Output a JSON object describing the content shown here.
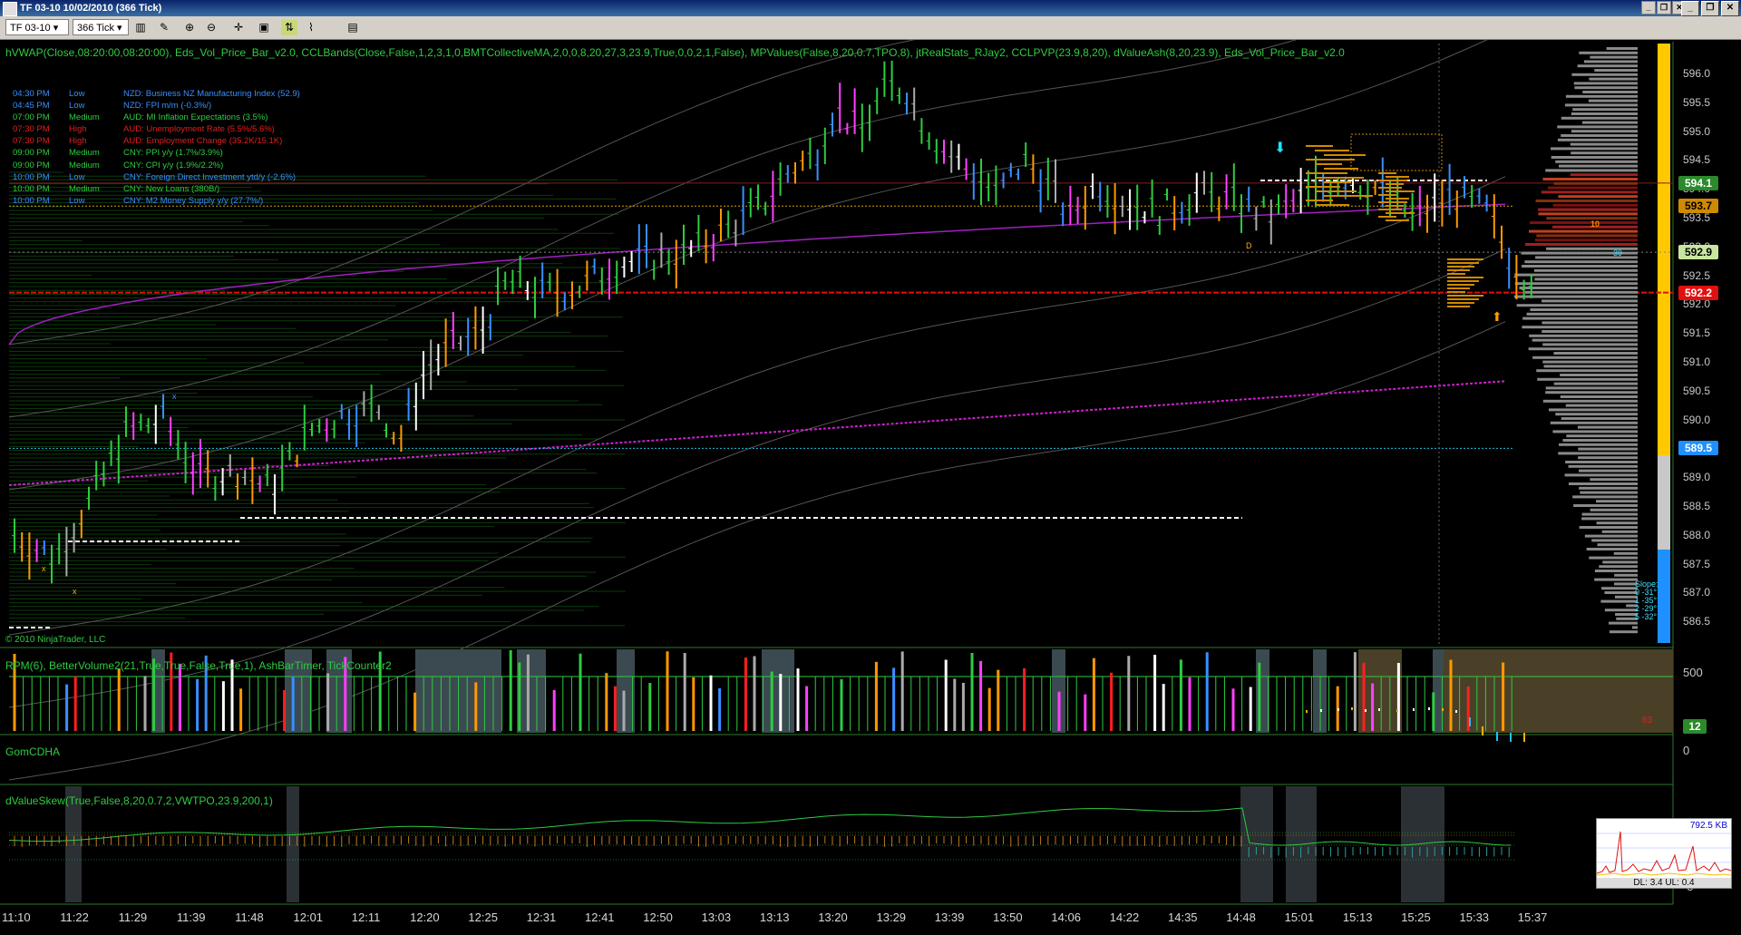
{
  "window": {
    "title": "TF 03-10  10/02/2010 (366 Tick)",
    "minimize_label": "_",
    "restore_label": "❐",
    "close_label": "✕"
  },
  "toolbar": {
    "instrument": "TF 03-10",
    "period": "366 Tick",
    "icons": [
      "bar-type-icon",
      "draw-tool-icon",
      "zoom-in-icon",
      "zoom-out-icon",
      "crosshair-icon",
      "properties-icon",
      "chart-trader-icon",
      "indicators-icon",
      "strategies-icon"
    ]
  },
  "panels": {
    "price_indicators": "hVWAP(Close,08:20:00,08:20:00), Eds_Vol_Price_Bar_v2.0, CCLBands(Close,False,1,2,3,1,0,BMTCollectiveMA,2,0,0,8,20,27,3,23.9,True,0,0,2,1,False), MPValues(False,8,20,0.7,TPO,8), jtRealStats_RJay2, CCLPVP(23.9,8,20), dValueAsh(8,20,23.9), Eds_Vol_Price_Bar_v2.0",
    "volume_indicators": "RPM(6), BetterVolume2(21,True,True,False,True,1), AshBarTimer, TickCounter2",
    "gom": "GomCDHA",
    "skew": "dValueSkew(True,False,8,20,0.7,2,VWTPO,23.9,200,1)",
    "copyright": "© 2010 NinjaTrader, LLC"
  },
  "news": [
    {
      "time": "04:30 PM",
      "impact": "Low",
      "event": "NZD: Business NZ Manufacturing Index (52.9)",
      "color": "#3a8fff"
    },
    {
      "time": "04:45 PM",
      "impact": "Low",
      "event": "NZD: FPI m/m (-0.3%/)",
      "color": "#3a8fff"
    },
    {
      "time": "07:00 PM",
      "impact": "Medium",
      "event": "AUD: MI Inflation Expectations (3.5%)",
      "color": "#2ecc40"
    },
    {
      "time": "07:30 PM",
      "impact": "High",
      "event": "AUD: Unemployment Rate (5.5%/5.6%)",
      "color": "#e02020"
    },
    {
      "time": "07:30 PM",
      "impact": "High",
      "event": "AUD: Employment Change (35.2K/15.1K)",
      "color": "#e02020"
    },
    {
      "time": "09:00 PM",
      "impact": "Medium",
      "event": "CNY: PPI y/y (1.7%/3.9%)",
      "color": "#2ecc40"
    },
    {
      "time": "09:00 PM",
      "impact": "Medium",
      "event": "CNY: CPI y/y (1.9%/2.2%)",
      "color": "#2ecc40"
    },
    {
      "time": "10:00 PM",
      "impact": "Low",
      "event": "CNY: Foreign Direct Investment ytd/y (-2.6%)",
      "color": "#3a8fff"
    },
    {
      "time": "10:00 PM",
      "impact": "Medium",
      "event": "CNY: New Loans (380B/)",
      "color": "#2ecc40"
    },
    {
      "time": "10:00 PM",
      "impact": "Low",
      "event": "CNY: M2 Money Supply y/y (27.7%/)",
      "color": "#3a8fff"
    }
  ],
  "price_axis": [
    "596.0",
    "595.5",
    "595.0",
    "594.5",
    "594.0",
    "593.5",
    "593.0",
    "592.5",
    "592.0",
    "591.5",
    "591.0",
    "590.5",
    "590.0",
    "589.5",
    "589.0",
    "588.5",
    "588.0",
    "587.5",
    "587.0",
    "586.5"
  ],
  "price_tags": [
    {
      "value": "594.1",
      "bg": "#2b8a2b",
      "fg": "#ffffff"
    },
    {
      "value": "593.7",
      "bg": "#d08a00",
      "fg": "#000000"
    },
    {
      "value": "592.9",
      "bg": "#c8e6a0",
      "fg": "#000000"
    },
    {
      "value": "592.2",
      "bg": "#e01010",
      "fg": "#ffffff"
    },
    {
      "value": "589.5",
      "bg": "#1e90ff",
      "fg": "#ffffff"
    }
  ],
  "volume_axis": {
    "top": "500",
    "tag": "12",
    "counter": "63"
  },
  "gom_axis": "0",
  "skew_axis": [
    "0",
    "-5"
  ],
  "time_axis": [
    "11:10",
    "11:22",
    "11:29",
    "11:39",
    "11:48",
    "12:01",
    "12:11",
    "12:20",
    "12:25",
    "12:31",
    "12:41",
    "12:50",
    "13:03",
    "13:13",
    "13:20",
    "13:29",
    "13:39",
    "13:50",
    "14:06",
    "14:22",
    "14:35",
    "14:48",
    "15:01",
    "15:13",
    "15:25",
    "15:33",
    "15:37"
  ],
  "markers": {
    "tpo": "10",
    "count": "39",
    "x1": "x",
    "x2": "x",
    "x3": "x",
    "d": "D"
  },
  "slope": {
    "title": "Slope:",
    "rows": [
      "0 -31°",
      "1 -35°",
      "2 -29°",
      "5 -32°"
    ]
  },
  "mini_monitor": {
    "rate": "792.5 KB",
    "status": "DL: 3.4 UL: 0.4"
  }
}
